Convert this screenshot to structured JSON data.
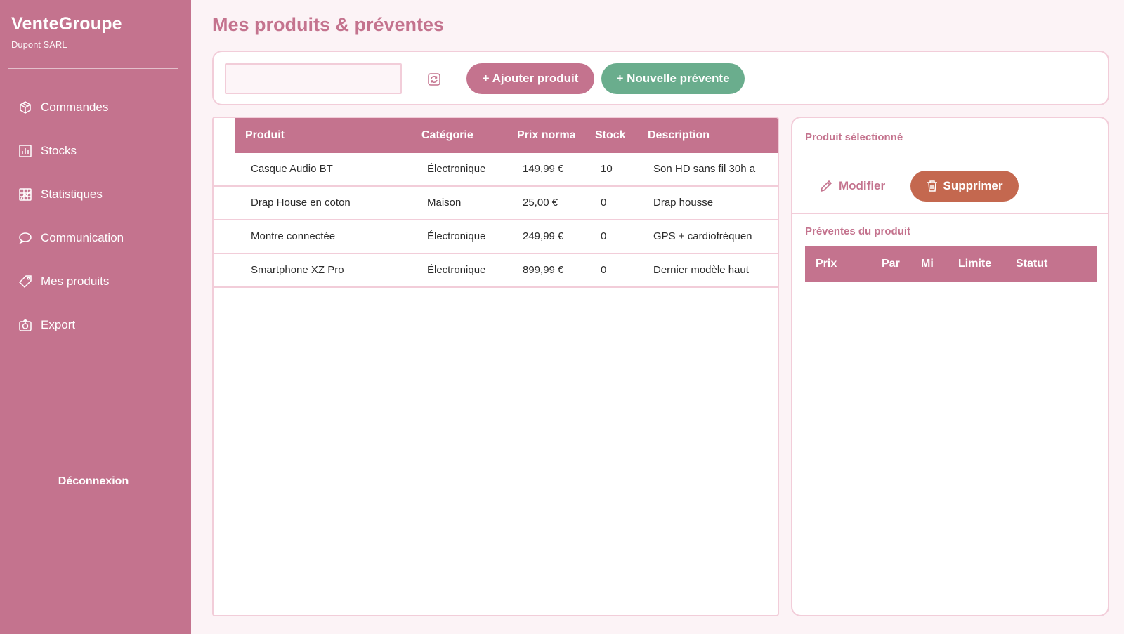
{
  "brand": {
    "title": "VenteGroupe",
    "subtitle": "Dupont SARL"
  },
  "sidebar": {
    "items": [
      {
        "label": "Commandes",
        "icon": "box-icon"
      },
      {
        "label": "Stocks",
        "icon": "bar-chart-icon"
      },
      {
        "label": "Statistiques",
        "icon": "stats-grid-icon"
      },
      {
        "label": "Communication",
        "icon": "chat-bubble-icon"
      },
      {
        "label": "Mes produits",
        "icon": "tag-icon"
      },
      {
        "label": "Export",
        "icon": "export-icon"
      }
    ],
    "logout": "Déconnexion"
  },
  "page": {
    "title": "Mes produits & préventes"
  },
  "toolbar": {
    "search_value": "",
    "refresh_icon": "refresh-icon",
    "add_product": "+ Ajouter produit",
    "new_presale": "+ Nouvelle prévente"
  },
  "products": {
    "columns": [
      "Produit",
      "Catégorie",
      "Prix normal",
      "Stock",
      "Description"
    ],
    "rows": [
      {
        "name": "Casque Audio BT",
        "category": "Électronique",
        "price": "149,99 €",
        "stock": "10",
        "description": "Son HD sans fil 30h a"
      },
      {
        "name": "Drap House en coton",
        "category": "Maison",
        "price": "25,00 €",
        "stock": "0",
        "description": "Drap housse"
      },
      {
        "name": "Montre connectée",
        "category": "Électronique",
        "price": "249,99 €",
        "stock": "0",
        "description": "GPS + cardiofréquen"
      },
      {
        "name": "Smartphone XZ Pro",
        "category": "Électronique",
        "price": "899,99 €",
        "stock": "0",
        "description": "Dernier modèle haut"
      }
    ]
  },
  "detail": {
    "title": "Produit sélectionné",
    "edit": "Modifier",
    "delete": "Supprimer",
    "presales_title": "Préventes du produit",
    "presales_columns": [
      "Prix",
      "Par",
      "Mi",
      "Limite",
      "Statut"
    ]
  },
  "colors": {
    "primary": "#c4738e",
    "success": "#6aad8d",
    "danger": "#c4684f",
    "background": "#fcf3f6",
    "border": "#f2cdd9"
  }
}
